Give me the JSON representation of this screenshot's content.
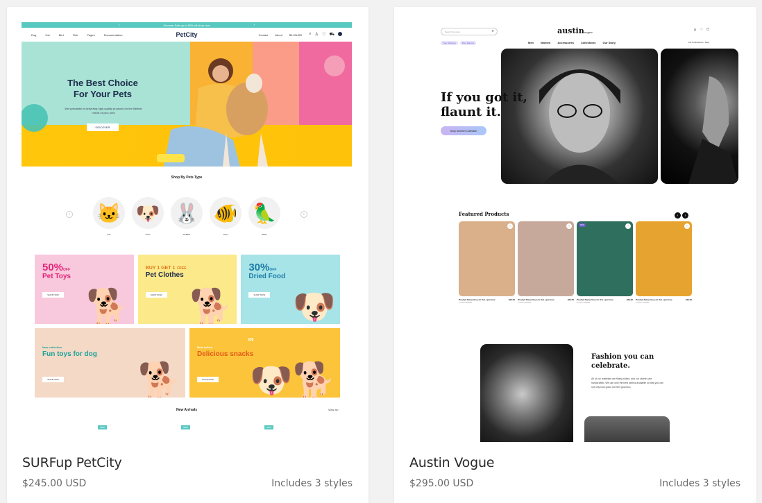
{
  "cards": [
    {
      "title": "SURFup PetCity",
      "price": "$245.00 USD",
      "styles": "Includes 3 styles",
      "preview": {
        "topbar": "Summer Sale up to 50% off shop now",
        "nav": [
          "Dog",
          "Cat",
          "Bird",
          "Fish",
          "Pages",
          "Documentation"
        ],
        "logo": "PetCity",
        "nav_right": [
          "Contact",
          "About"
        ],
        "currency": "$0.00USD",
        "hero_title": "The Best Choice For Your Pets",
        "hero_sub": "We specialise in delivering high-quality products for the lifetime needs of your pets",
        "hero_button": "DISCOVER",
        "pets_title": "Shop By Pets Type",
        "pets": [
          "CAT",
          "DOG",
          "RABBIT",
          "FISH",
          "BIRD"
        ],
        "promos": [
          {
            "big": "50%",
            "small": "OFF",
            "title": "Pet Toys",
            "button": "SHOP NOW",
            "bg": "#f8c8dc",
            "color": "#e2267a"
          },
          {
            "big": "BUY 1 GET 1",
            "small": "FREE",
            "title": "Pet Clothes",
            "button": "SHOP NOW",
            "bg": "#fbe98a",
            "color": "#e07a1a"
          },
          {
            "big": "30%",
            "small": "OFF",
            "title": "Dried Food",
            "button": "SHOP NOW",
            "bg": "#a7e4e8",
            "color": "#1d7ca8"
          }
        ],
        "promos2": [
          {
            "kicker": "New collection",
            "title": "Fun toys for dog",
            "button": "SHOP NOW",
            "bg": "#f4d9c6",
            "color": "#1aa39a"
          },
          {
            "kicker": "Best sellers",
            "title": "Delicious snacks",
            "badge": "50$",
            "button": "SHOP NOW",
            "bg": "#fbc43a",
            "color": "#e05a1a"
          }
        ],
        "arrivals_title": "New Arrivals",
        "view_all": "View all",
        "new_badge": "NEW"
      }
    },
    {
      "title": "Austin Vogue",
      "price": "$295.00 USD",
      "styles": "Includes 3 styles",
      "preview": {
        "search_placeholder": "Search the store",
        "logo": "austin",
        "logo_sub": "vogue",
        "pills": [
          "Free Shipping",
          "Free Returns"
        ],
        "menu": [
          "Men",
          "Women",
          "Accessories",
          "Collections",
          "Our Story"
        ],
        "login": "Get Notifications / Blog",
        "hero_title": "If you got it, flaunt it.",
        "hero_button": "Shop Summer Collection",
        "featured_title": "Featured Products",
        "products": [
          {
            "name": "Product Name Goes In this spot here",
            "price": "$49.95",
            "avail": "3 colors available",
            "bg": "#d9b08a",
            "tag": ""
          },
          {
            "name": "Product Name Goes In this spot here",
            "price": "$49.95",
            "avail": "3 colors available",
            "bg": "#c7a99b",
            "tag": ""
          },
          {
            "name": "Product Name Goes In this spot here",
            "price": "$49.95",
            "avail": "3 colors available",
            "bg": "#2f6f5e",
            "tag": "NEW"
          },
          {
            "name": "Product Name Goes In this spot here",
            "price": "$49.95",
            "avail": "3 colors available",
            "bg": "#e7a32f",
            "tag": ""
          }
        ],
        "block_title": "Fashion you can celebrate.",
        "block_text": "All of our materials are finely picked, and our clothes are handcrafted. We use only the best fabrics available so that you can not only look good, but feel good too."
      }
    }
  ]
}
